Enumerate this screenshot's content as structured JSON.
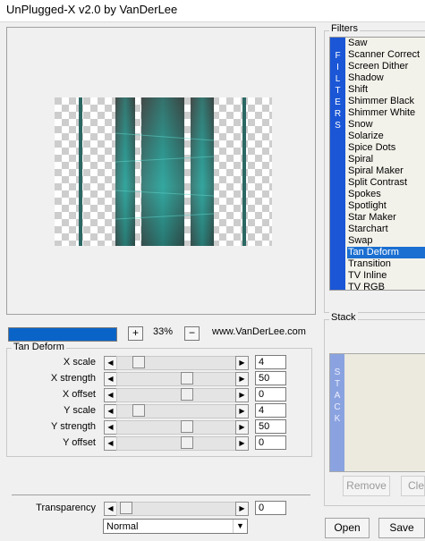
{
  "window": {
    "title": "UnPlugged-X v2.0 by VanDerLee"
  },
  "preview": {
    "zoom": "33%",
    "site": "www.VanDerLee.com",
    "progress": 1.0
  },
  "params": {
    "group_label": "Tan Deform",
    "rows": [
      {
        "label": "X scale",
        "value": "4"
      },
      {
        "label": "X strength",
        "value": "50"
      },
      {
        "label": "X offset",
        "value": "0"
      },
      {
        "label": "Y scale",
        "value": "4"
      },
      {
        "label": "Y strength",
        "value": "50"
      },
      {
        "label": "Y offset",
        "value": "0"
      }
    ],
    "transparency": {
      "label": "Transparency",
      "value": "0"
    },
    "blend": "Normal"
  },
  "filters": {
    "group_label": "Filters",
    "band": [
      "F",
      "I",
      "L",
      "T",
      "E",
      "R",
      "S"
    ],
    "items": [
      "Saw",
      "Scanner Correct",
      "Screen Dither",
      "Shadow",
      "Shift",
      "Shimmer Black",
      "Shimmer White",
      "Snow",
      "Solarize",
      "Spice Dots",
      "Spiral",
      "Spiral Maker",
      "Split Contrast",
      "Spokes",
      "Spotlight",
      "Star Maker",
      "Starchart",
      "Swap",
      "Tan Deform",
      "Transition",
      "TV Inline",
      "TV RGB"
    ],
    "selected": "Tan Deform"
  },
  "stack": {
    "group_label": "Stack",
    "band": [
      "S",
      "T",
      "A",
      "C",
      "K"
    ],
    "remove": "Remove",
    "clear": "Cle"
  },
  "buttons": {
    "open": "Open",
    "save": "Save"
  },
  "icons": {
    "zoom_in": "+",
    "zoom_out": "−",
    "arrow_left": "◀",
    "arrow_right": "▶",
    "dropdown": "▼"
  },
  "colors": {
    "accent": "#1a6fd1",
    "teal": "#2aa29a"
  }
}
